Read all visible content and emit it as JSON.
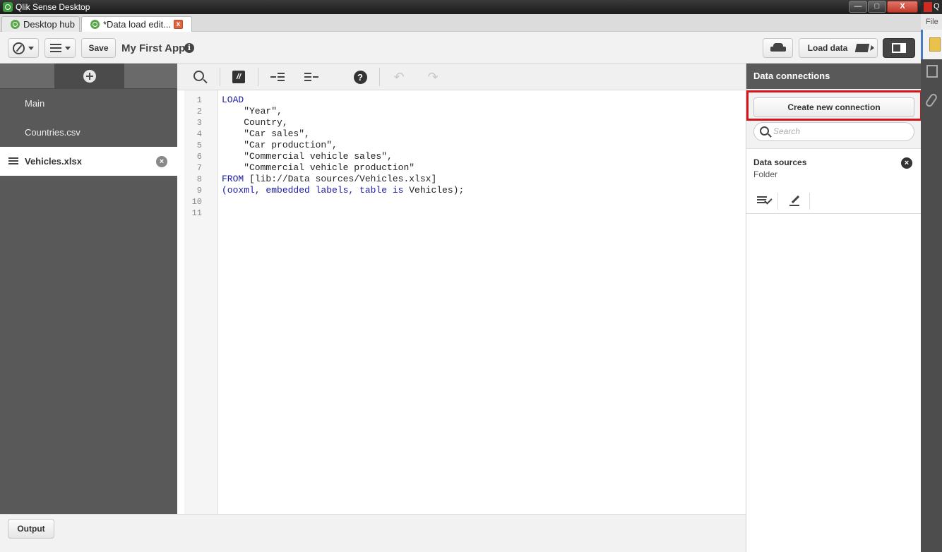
{
  "window": {
    "title": "Qlik Sense Desktop",
    "controls": [
      "—",
      "□",
      "X"
    ]
  },
  "tabs": [
    {
      "label": "Desktop hub",
      "active": false
    },
    {
      "label": "*Data load edit...",
      "active": true,
      "close": "x"
    }
  ],
  "toolbar": {
    "save_label": "Save",
    "app_title": "My First App",
    "info": "i",
    "load_data_label": "Load data"
  },
  "sections": [
    {
      "label": "Main",
      "active": false
    },
    {
      "label": "Countries.csv",
      "active": false
    },
    {
      "label": "Vehicles.xlsx",
      "active": true,
      "delete": "×"
    }
  ],
  "editor": {
    "comment_glyph": "//",
    "help_glyph": "?",
    "undo_glyph": "↶",
    "redo_glyph": "↷",
    "line_numbers": [
      "1",
      "2",
      "3",
      "4",
      "5",
      "6",
      "7",
      "8",
      "9",
      "10",
      "11"
    ],
    "code": {
      "l1_kw": "LOAD",
      "l2": "    \"Year\",",
      "l3": "    Country,",
      "l4": "    \"Car sales\",",
      "l5": "    \"Car production\",",
      "l6": "    \"Commercial vehicle sales\",",
      "l7": "    \"Commercial vehicle production\"",
      "l8_kw": "FROM",
      "l8_rest": " [lib://Data sources/Vehicles.xlsx]",
      "l9_a": "(ooxml, embedded labels, table",
      "l9_is": " is",
      "l9_b": " Vehicles);"
    }
  },
  "bottom": {
    "output_label": "Output"
  },
  "data_connections": {
    "header": "Data connections",
    "create_label": "Create new connection",
    "search_placeholder": "Search",
    "items": [
      {
        "name": "Data sources",
        "type": "Folder",
        "delete": "×"
      }
    ]
  },
  "side_window": {
    "q": "Q",
    "file_label": "File"
  },
  "colors": {
    "highlight": "#d4141a",
    "keyword": "#1a1aa6",
    "panel_dark": "#595959"
  }
}
